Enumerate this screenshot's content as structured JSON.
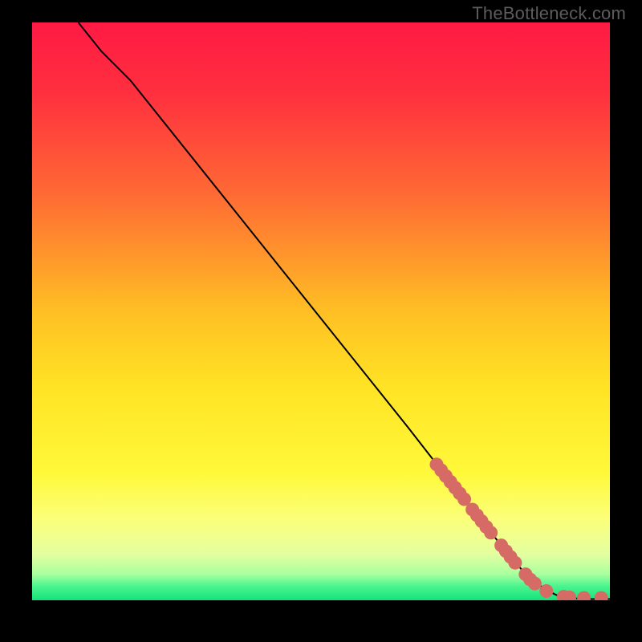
{
  "attribution": "TheBottleneck.com",
  "chart_data": {
    "type": "line",
    "title": "",
    "xlabel": "",
    "ylabel": "",
    "xlim": [
      0,
      100
    ],
    "ylim": [
      0,
      100
    ],
    "background_gradient_stops": [
      {
        "offset": 0.0,
        "color": "#ff1a44"
      },
      {
        "offset": 0.12,
        "color": "#ff2f3f"
      },
      {
        "offset": 0.3,
        "color": "#ff6b34"
      },
      {
        "offset": 0.5,
        "color": "#ffbf24"
      },
      {
        "offset": 0.63,
        "color": "#ffe324"
      },
      {
        "offset": 0.78,
        "color": "#fff93a"
      },
      {
        "offset": 0.86,
        "color": "#fbff7a"
      },
      {
        "offset": 0.92,
        "color": "#e4ffa0"
      },
      {
        "offset": 0.955,
        "color": "#a9ff9e"
      },
      {
        "offset": 0.975,
        "color": "#4cf58f"
      },
      {
        "offset": 1.0,
        "color": "#14e27a"
      }
    ],
    "curve": [
      {
        "x": 8.0,
        "y": 100.0
      },
      {
        "x": 10.0,
        "y": 97.5
      },
      {
        "x": 12.0,
        "y": 95.0
      },
      {
        "x": 14.0,
        "y": 93.0
      },
      {
        "x": 17.0,
        "y": 90.0
      },
      {
        "x": 21.0,
        "y": 85.0
      },
      {
        "x": 27.0,
        "y": 77.5
      },
      {
        "x": 35.0,
        "y": 67.5
      },
      {
        "x": 45.0,
        "y": 55.0
      },
      {
        "x": 55.0,
        "y": 42.5
      },
      {
        "x": 65.0,
        "y": 30.0
      },
      {
        "x": 72.0,
        "y": 21.0
      },
      {
        "x": 78.0,
        "y": 13.5
      },
      {
        "x": 82.0,
        "y": 8.5
      },
      {
        "x": 85.0,
        "y": 5.0
      },
      {
        "x": 87.5,
        "y": 2.8
      },
      {
        "x": 89.5,
        "y": 1.5
      },
      {
        "x": 91.0,
        "y": 0.8
      },
      {
        "x": 93.0,
        "y": 0.4
      },
      {
        "x": 96.0,
        "y": 0.2
      },
      {
        "x": 100.0,
        "y": 0.2
      }
    ],
    "markers": [
      {
        "x": 70.0,
        "y": 23.5
      },
      {
        "x": 70.8,
        "y": 22.5
      },
      {
        "x": 71.6,
        "y": 21.5
      },
      {
        "x": 72.4,
        "y": 20.5
      },
      {
        "x": 73.2,
        "y": 19.5
      },
      {
        "x": 74.0,
        "y": 18.5
      },
      {
        "x": 74.8,
        "y": 17.5
      },
      {
        "x": 76.2,
        "y": 15.7
      },
      {
        "x": 77.0,
        "y": 14.7
      },
      {
        "x": 77.8,
        "y": 13.7
      },
      {
        "x": 78.6,
        "y": 12.7
      },
      {
        "x": 79.4,
        "y": 11.7
      },
      {
        "x": 81.2,
        "y": 9.5
      },
      {
        "x": 82.0,
        "y": 8.5
      },
      {
        "x": 82.8,
        "y": 7.5
      },
      {
        "x": 83.6,
        "y": 6.5
      },
      {
        "x": 85.4,
        "y": 4.5
      },
      {
        "x": 86.2,
        "y": 3.6
      },
      {
        "x": 87.0,
        "y": 2.9
      },
      {
        "x": 89.0,
        "y": 1.6
      },
      {
        "x": 92.0,
        "y": 0.6
      },
      {
        "x": 93.0,
        "y": 0.5
      },
      {
        "x": 95.5,
        "y": 0.4
      },
      {
        "x": 98.5,
        "y": 0.4
      }
    ],
    "marker_color": "#d66a65",
    "curve_color": "#000000"
  }
}
